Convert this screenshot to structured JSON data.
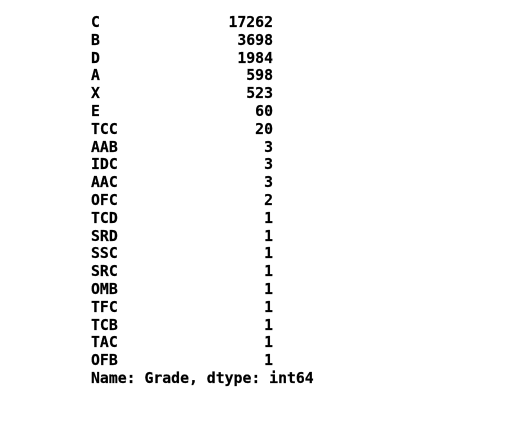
{
  "series": {
    "rows": [
      {
        "key": "C",
        "value": "17262"
      },
      {
        "key": "B",
        "value": "3698"
      },
      {
        "key": "D",
        "value": "1984"
      },
      {
        "key": "A",
        "value": "598"
      },
      {
        "key": "X",
        "value": "523"
      },
      {
        "key": "E",
        "value": "60"
      },
      {
        "key": "TCC",
        "value": "20"
      },
      {
        "key": "AAB",
        "value": "3"
      },
      {
        "key": "IDC",
        "value": "3"
      },
      {
        "key": "AAC",
        "value": "3"
      },
      {
        "key": "OFC",
        "value": "2"
      },
      {
        "key": "TCD",
        "value": "1"
      },
      {
        "key": "SRD",
        "value": "1"
      },
      {
        "key": "SSC",
        "value": "1"
      },
      {
        "key": "SRC",
        "value": "1"
      },
      {
        "key": "OMB",
        "value": "1"
      },
      {
        "key": "TFC",
        "value": "1"
      },
      {
        "key": "TCB",
        "value": "1"
      },
      {
        "key": "TAC",
        "value": "1"
      },
      {
        "key": "OFB",
        "value": "1"
      }
    ],
    "footer": "Name: Grade, dtype: int64"
  }
}
